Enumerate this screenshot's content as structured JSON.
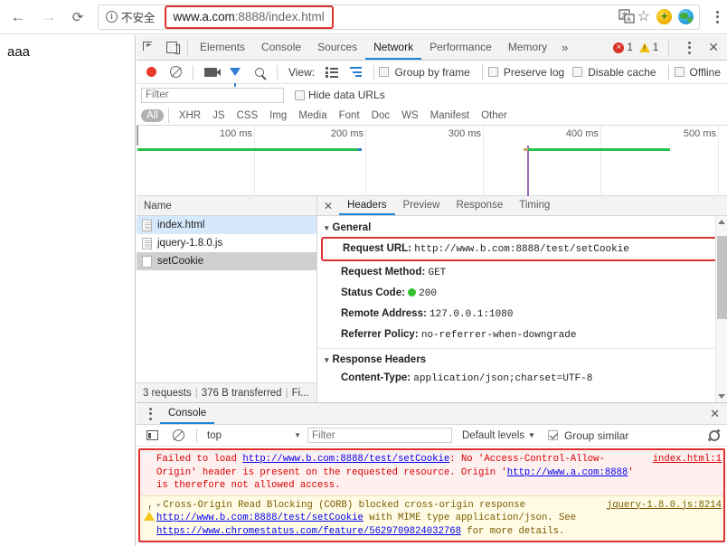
{
  "browser": {
    "back_icon": "←",
    "forward_icon": "→",
    "reload_icon": "⟳",
    "security_label": "不安全",
    "url_main": "www.a.com",
    "url_dim": ":8888/index.html",
    "star_icon": "☆"
  },
  "page": {
    "body_text": "aaa"
  },
  "devtools": {
    "tabs": [
      {
        "label": "Elements",
        "active": false
      },
      {
        "label": "Console",
        "active": false
      },
      {
        "label": "Sources",
        "active": false
      },
      {
        "label": "Network",
        "active": true
      },
      {
        "label": "Performance",
        "active": false
      },
      {
        "label": "Memory",
        "active": false
      }
    ],
    "more_tabs_icon": "»",
    "error_count": "1",
    "warning_count": "1",
    "close_icon": "✕",
    "network_toolbar": {
      "view_label": "View:",
      "checkboxes": [
        {
          "label": "Group by frame",
          "checked": false
        },
        {
          "label": "Preserve log",
          "checked": false
        },
        {
          "label": "Disable cache",
          "checked": false
        },
        {
          "label": "Offline",
          "checked": false
        }
      ]
    },
    "filter": {
      "placeholder": "Filter",
      "hide_data_urls_label": "Hide data URLs",
      "hide_data_urls_checked": false,
      "types": [
        "All",
        "XHR",
        "JS",
        "CSS",
        "Img",
        "Media",
        "Font",
        "Doc",
        "WS",
        "Manifest",
        "Other"
      ],
      "active_type": "All"
    },
    "overview": {
      "ticks": [
        "100 ms",
        "200 ms",
        "300 ms",
        "400 ms",
        "500 ms"
      ]
    },
    "requests": {
      "column_header": "Name",
      "rows": [
        {
          "name": "index.html",
          "icon": "document-icon",
          "state": "selected"
        },
        {
          "name": "jquery-1.8.0.js",
          "icon": "document-icon",
          "state": "normal"
        },
        {
          "name": "setCookie",
          "icon": "blank-document-icon",
          "state": "highlighted"
        }
      ],
      "status_requests": "3 requests",
      "status_transferred": "376 B transferred",
      "status_finish": "Fi..."
    },
    "details": {
      "close_icon": "✕",
      "tabs": [
        {
          "label": "Headers",
          "active": true
        },
        {
          "label": "Preview",
          "active": false
        },
        {
          "label": "Response",
          "active": false
        },
        {
          "label": "Timing",
          "active": false
        }
      ],
      "general_title": "General",
      "general": [
        {
          "key": "Request URL:",
          "value": "http://www.b.com:8888/test/setCookie",
          "highlighted": true
        },
        {
          "key": "Request Method:",
          "value": "GET",
          "highlighted": false
        },
        {
          "key": "Status Code:",
          "value": "200",
          "highlighted": false,
          "status_dot": true
        },
        {
          "key": "Remote Address:",
          "value": "127.0.0.1:1080",
          "highlighted": false
        },
        {
          "key": "Referrer Policy:",
          "value": "no-referrer-when-downgrade",
          "highlighted": false
        }
      ],
      "response_headers_title": "Response Headers",
      "response_headers": [
        {
          "key": "Content-Type:",
          "value": "application/json;charset=UTF-8"
        }
      ]
    },
    "console": {
      "tab_label": "Console",
      "close_icon": "✕",
      "context": "top",
      "filter_placeholder": "Filter",
      "levels_label": "Default levels",
      "group_similar_label": "Group similar",
      "group_similar_checked": true,
      "messages": [
        {
          "type": "error",
          "source": "index.html:1",
          "parts": [
            {
              "t": "Failed to load ",
              "link": false
            },
            {
              "t": "http://www.b.com:8888/test/setCookie",
              "link": true
            },
            {
              "t": ": No 'Access-Control-Allow-Origin' header is present on the requested resource. Origin '",
              "link": false
            },
            {
              "t": "http://www.a.com:8888",
              "link": true
            },
            {
              "t": "' is therefore not allowed access.",
              "link": false
            }
          ]
        },
        {
          "type": "warning",
          "source": "jquery-1.8.0.js:8214",
          "parts": [
            {
              "t": "Cross-Origin Read Blocking (CORB) blocked cross-origin response ",
              "link": false
            },
            {
              "t": "http://www.b.com:8888/test/setCookie",
              "link": true
            },
            {
              "t": " with MIME type application/json. See ",
              "link": false
            },
            {
              "t": "https://www.chromestatus.com/feature/5629709824032768",
              "link": true
            },
            {
              "t": " for more details.",
              "link": false
            }
          ]
        }
      ]
    }
  },
  "colors": {
    "accent_blue": "#1a86d8",
    "error_red": "#d93025",
    "warn_yellow": "#f5c518",
    "highlight_box": "#e03030",
    "success_green": "#2fbf2f",
    "timeline_green": "#27c24c"
  }
}
